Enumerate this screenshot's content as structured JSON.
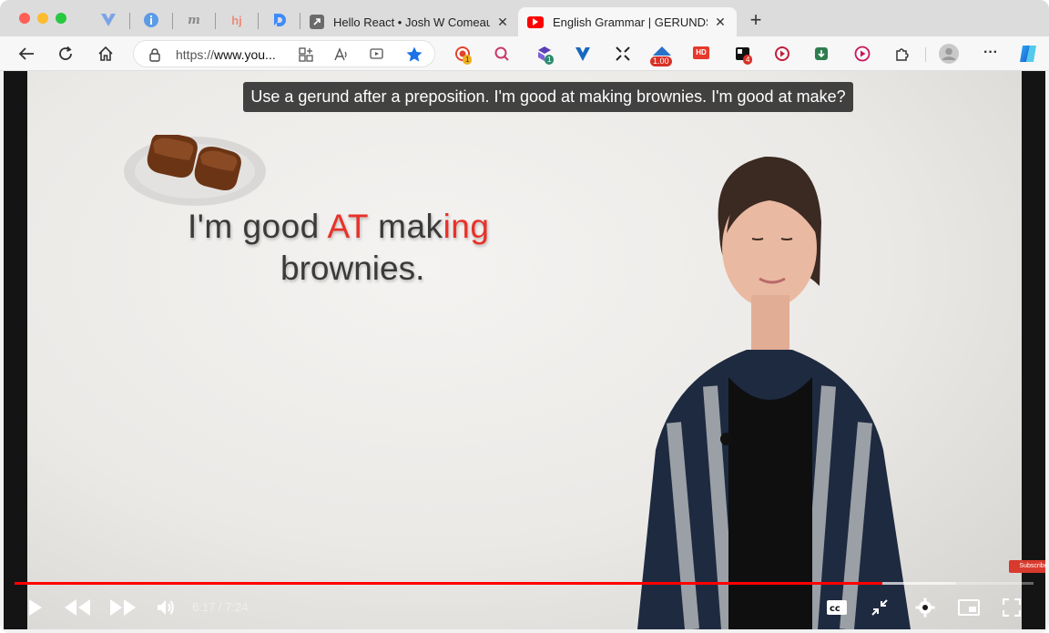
{
  "tabs": {
    "pinned": [
      {
        "name": "vuetify-tab-icon",
        "glyph": "V",
        "color": "#5b8dd9"
      },
      {
        "name": "info-tab-icon",
        "glyph": "i",
        "color": "#4a90e2"
      },
      {
        "name": "m-tab-icon",
        "glyph": "m",
        "color": "#8a8a8a"
      },
      {
        "name": "hj-tab-icon",
        "glyph": "hj",
        "color": "#f08a78"
      },
      {
        "name": "d-tab-icon",
        "glyph": "D",
        "color": "#3d8bfd"
      }
    ],
    "react_title": "Hello React • Josh W Comeau",
    "active_title": "English Grammar | GERUNDS in",
    "close_glyph": "✕",
    "new_tab_glyph": "+"
  },
  "toolbar": {
    "url_prefix": "https://",
    "url_host": "www.you...",
    "extension_badges": {
      "ext1": "1",
      "ext3": "1",
      "speed": "1.00",
      "hd": "HD",
      "ext8": "4"
    },
    "star_color": "#1a73e8",
    "more_glyph": "···"
  },
  "video": {
    "caption": "Use a gerund after a preposition. I'm good at making brownies. I'm good at make?",
    "slide": {
      "part1": "I'm good ",
      "part2": "AT",
      "part3": " mak",
      "part4": "ing",
      "line2": "brownies."
    },
    "subscribe_label": "Subscribe",
    "time": "6:17 / 7:24",
    "progress_fraction": 0.852,
    "accent": "#ff0000"
  }
}
